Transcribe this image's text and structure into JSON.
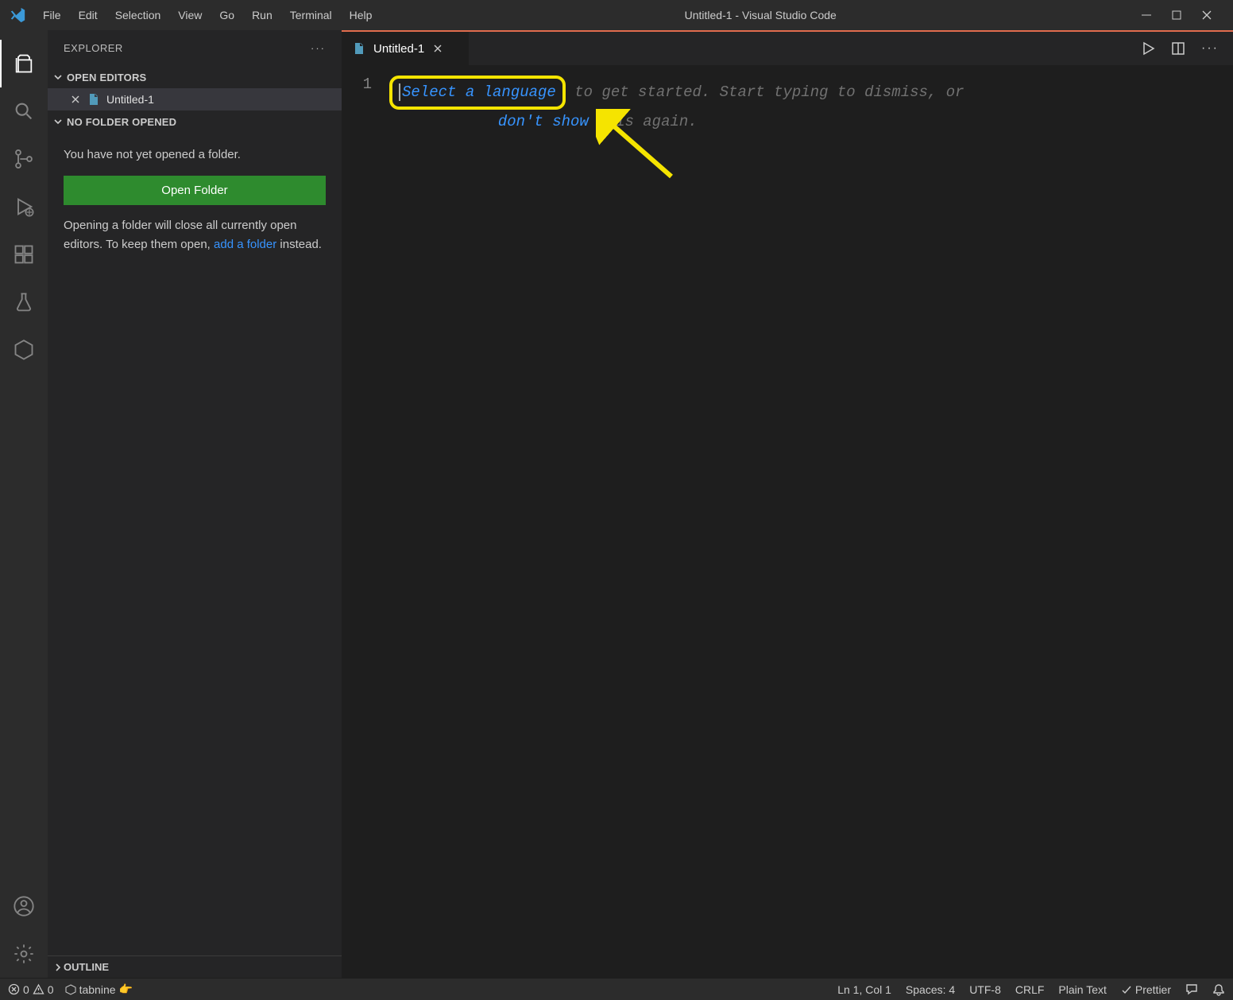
{
  "titlebar": {
    "menu": [
      "File",
      "Edit",
      "Selection",
      "View",
      "Go",
      "Run",
      "Terminal",
      "Help"
    ],
    "title": "Untitled-1 - Visual Studio Code"
  },
  "activitybar": {
    "icons": [
      "files",
      "search",
      "source-control",
      "debug",
      "extensions",
      "beaker",
      "hexagon"
    ],
    "bottom_icons": [
      "account",
      "gear"
    ]
  },
  "sidebar": {
    "title": "EXPLORER",
    "open_editors_label": "OPEN EDITORS",
    "open_editor_file": "Untitled-1",
    "no_folder_label": "NO FOLDER OPENED",
    "no_folder_text": "You have not yet opened a folder.",
    "open_folder_btn": "Open Folder",
    "hint_prefix": "Opening a folder will close all currently open editors. To keep them open, ",
    "hint_link": "add a folder",
    "hint_suffix": " instead.",
    "outline_label": "OUTLINE"
  },
  "editor": {
    "tab_label": "Untitled-1",
    "line_number": "1",
    "placeholder_select": "Select a language",
    "placeholder_mid1": " to get started. Start typing to dismiss, or ",
    "placeholder_link": "don't show",
    "placeholder_mid2": " this again."
  },
  "statusbar": {
    "errors": "0",
    "warnings": "0",
    "tabnine": "tabnine",
    "ln_col": "Ln 1, Col 1",
    "spaces": "Spaces: 4",
    "encoding": "UTF-8",
    "eol": "CRLF",
    "lang": "Plain Text",
    "prettier": "Prettier"
  }
}
